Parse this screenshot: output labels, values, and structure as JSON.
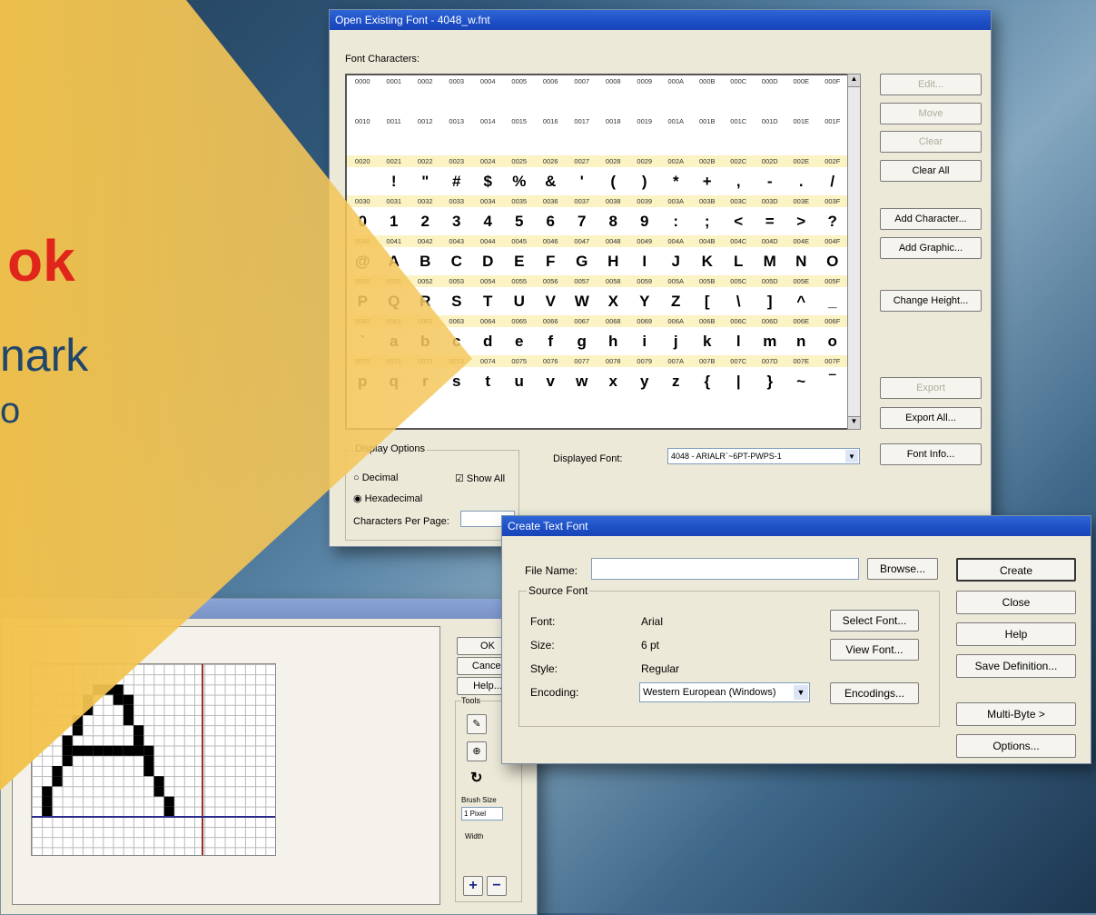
{
  "ribbon": {
    "bold": "ok",
    "line2": "nark",
    "line3": "o"
  },
  "font_window": {
    "title": "Open Existing Font - 4048_w.fnt",
    "chars_label": "Font Characters:",
    "rows": [
      {
        "codes": [
          "0000",
          "0001",
          "0002",
          "0003",
          "0004",
          "0005",
          "0006",
          "0007",
          "0008",
          "0009",
          "000A",
          "000B",
          "000C",
          "000D",
          "000E",
          "000F"
        ],
        "chars": [
          "",
          "",
          "",
          "",
          "",
          "",
          "",
          "",
          "",
          "",
          "",
          "",
          "",
          "",
          "",
          ""
        ]
      },
      {
        "codes": [
          "0010",
          "0011",
          "0012",
          "0013",
          "0014",
          "0015",
          "0016",
          "0017",
          "0018",
          "0019",
          "001A",
          "001B",
          "001C",
          "001D",
          "001E",
          "001F"
        ],
        "chars": [
          "",
          "",
          "",
          "",
          "",
          "",
          "",
          "",
          "",
          "",
          "",
          "",
          "",
          "",
          "",
          ""
        ]
      },
      {
        "codes": [
          "0020",
          "0021",
          "0022",
          "0023",
          "0024",
          "0025",
          "0026",
          "0027",
          "0028",
          "0029",
          "002A",
          "002B",
          "002C",
          "002D",
          "002E",
          "002F"
        ],
        "chars": [
          "",
          " !",
          "\"",
          "#",
          "$",
          "%",
          "&",
          "'",
          "(",
          ")",
          "*",
          "+",
          ",",
          "-",
          ".",
          "/"
        ]
      },
      {
        "codes": [
          "0030",
          "0031",
          "0032",
          "0033",
          "0034",
          "0035",
          "0036",
          "0037",
          "0038",
          "0039",
          "003A",
          "003B",
          "003C",
          "003D",
          "003E",
          "003F"
        ],
        "chars": [
          "0",
          "1",
          "2",
          "3",
          "4",
          "5",
          "6",
          "7",
          "8",
          "9",
          ":",
          ";",
          "<",
          "=",
          ">",
          "?"
        ]
      },
      {
        "codes": [
          "0040",
          "0041",
          "0042",
          "0043",
          "0044",
          "0045",
          "0046",
          "0047",
          "0048",
          "0049",
          "004A",
          "004B",
          "004C",
          "004D",
          "004E",
          "004F"
        ],
        "chars": [
          "@",
          "A",
          "B",
          "C",
          "D",
          "E",
          "F",
          "G",
          "H",
          "I",
          "J",
          "K",
          "L",
          "M",
          "N",
          "O"
        ]
      },
      {
        "codes": [
          "0050",
          "0051",
          "0052",
          "0053",
          "0054",
          "0055",
          "0056",
          "0057",
          "0058",
          "0059",
          "005A",
          "005B",
          "005C",
          "005D",
          "005E",
          "005F"
        ],
        "chars": [
          "P",
          "Q",
          "R",
          "S",
          "T",
          "U",
          "V",
          "W",
          "X",
          "Y",
          "Z",
          "[",
          "\\",
          "]",
          "^",
          "_"
        ]
      },
      {
        "codes": [
          "0060",
          "0061",
          "0062",
          "0063",
          "0064",
          "0065",
          "0066",
          "0067",
          "0068",
          "0069",
          "006A",
          "006B",
          "006C",
          "006D",
          "006E",
          "006F"
        ],
        "chars": [
          "`",
          "a",
          "b",
          "c",
          "d",
          "e",
          "f",
          "g",
          "h",
          "i",
          "j",
          "k",
          "l",
          "m",
          "n",
          "o"
        ]
      },
      {
        "codes": [
          "0070",
          "0071",
          "0072",
          "0073",
          "0074",
          "0075",
          "0076",
          "0077",
          "0078",
          "0079",
          "007A",
          "007B",
          "007C",
          "007D",
          "007E",
          "007F"
        ],
        "chars": [
          "p",
          "q",
          "r",
          "s",
          "t",
          "u",
          "v",
          "w",
          "x",
          "y",
          "z",
          "{",
          "|",
          "}",
          "~",
          "‾"
        ]
      }
    ],
    "buttons": {
      "edit": "Edit...",
      "move": "Move",
      "clear": "Clear",
      "clear_all": "Clear All",
      "add_character": "Add Character...",
      "add_graphic": "Add Graphic...",
      "change_height": "Change Height...",
      "export": "Export",
      "export_all": "Export All...",
      "font_info": "Font Info..."
    },
    "display_options": {
      "group": "Display Options",
      "decimal": "Decimal",
      "hexadecimal": "Hexadecimal",
      "show_all": "Show All",
      "chars_per_page": "Characters Per Page:"
    },
    "displayed_font_label": "Displayed Font:",
    "displayed_font_value": "4048 - ARIALR`~6PT-PWPS-1"
  },
  "edit_window": {
    "buttons": {
      "ok": "OK",
      "cancel": "Cancel",
      "help": "Help..."
    },
    "tools_label": "Tools",
    "brush_size_label": "Brush Size",
    "brush_size_value": "1 Pixel",
    "width_label": "Width"
  },
  "text_font_dialog": {
    "title": "Create Text Font",
    "file_name_label": "File Name:",
    "file_name_value": "",
    "browse": "Browse...",
    "source_font_group": "Source Font",
    "font_label": "Font:",
    "font_value": "Arial",
    "size_label": "Size:",
    "size_value": "6 pt",
    "style_label": "Style:",
    "style_value": "Regular",
    "encoding_label": "Encoding:",
    "encoding_value": "Western European (Windows)",
    "select_font": "Select Font...",
    "view_font": "View Font...",
    "encodings": "Encodings...",
    "create": "Create",
    "close": "Close",
    "help": "Help",
    "save_definition": "Save Definition...",
    "multi_byte": "Multi-Byte >",
    "options": "Options..."
  }
}
